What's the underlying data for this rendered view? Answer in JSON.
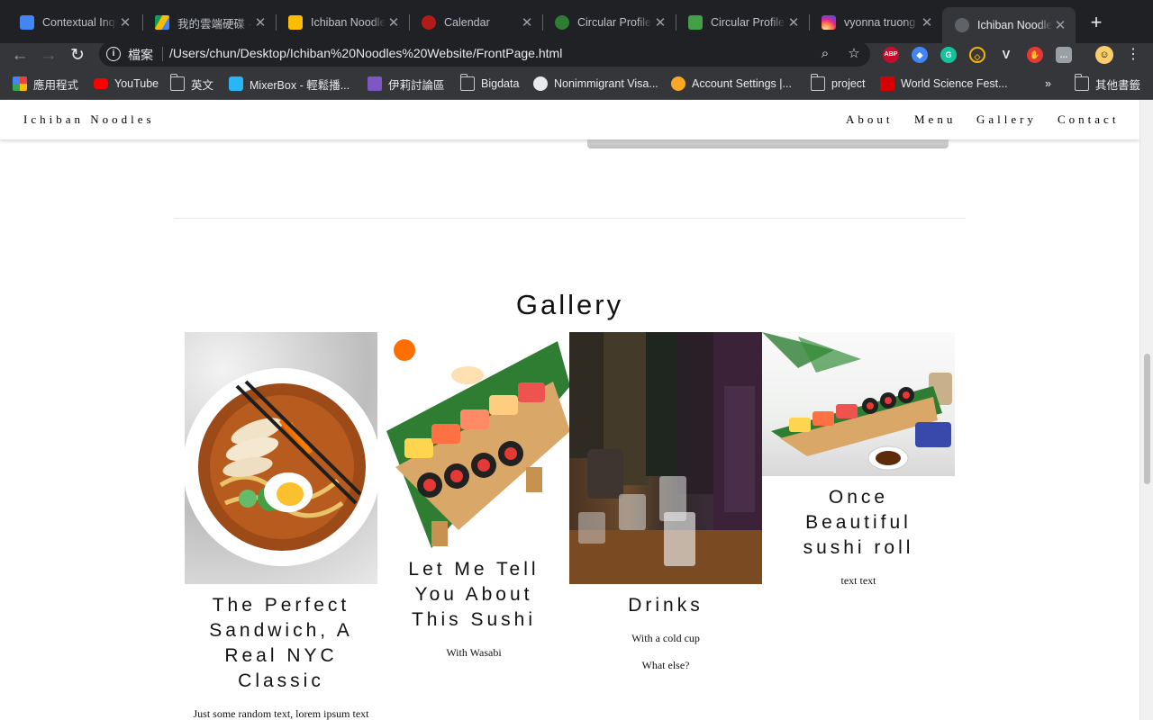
{
  "tabs": [
    {
      "title": "Contextual Inqu",
      "favicon_color": "#4285f4"
    },
    {
      "title": "我的雲端硬碟 -",
      "favicon_color": "#0f9d58"
    },
    {
      "title": "Ichiban Noodle",
      "favicon_color": "#fbbc04"
    },
    {
      "title": "Calendar",
      "favicon_color": "#b31b1b"
    },
    {
      "title": "Circular Profile",
      "favicon_color": "#2e7d32"
    },
    {
      "title": "Circular Profile",
      "favicon_color": "#43a047"
    },
    {
      "title": "vyonna truong",
      "favicon_color": "#d62976"
    },
    {
      "title": "Ichiban Noodle",
      "favicon_color": "#5f6368"
    }
  ],
  "omnibox": {
    "security_label": "檔案",
    "url": "/Users/chun/Desktop/Ichiban%20Noodles%20Website/FrontPage.html"
  },
  "extensions": [
    {
      "label": "ABP",
      "color": "#c70d2c"
    },
    {
      "label": "◆",
      "color": "#4285f4"
    },
    {
      "label": "G",
      "color": "#15c39a"
    },
    {
      "label": "◇",
      "color": "#f4b400"
    },
    {
      "label": "V",
      "color": "#35363a"
    },
    {
      "label": "✋",
      "color": "#e53935"
    },
    {
      "label": "…",
      "color": "#9aa0a6"
    }
  ],
  "bookmarks": [
    {
      "label": "應用程式",
      "icon": "apps-grid-icon"
    },
    {
      "label": "YouTube",
      "icon": "youtube-icon"
    },
    {
      "label": "英文",
      "icon": "folder-icon"
    },
    {
      "label": "MixerBox - 輕鬆播...",
      "icon": "mixerbox-icon"
    },
    {
      "label": "伊莉討論區",
      "icon": "eyny-icon"
    },
    {
      "label": "Bigdata",
      "icon": "folder-icon"
    },
    {
      "label": "Nonimmigrant Visa...",
      "icon": "globe-icon"
    },
    {
      "label": "Account Settings |...",
      "icon": "c-logo-icon"
    },
    {
      "label": "project",
      "icon": "folder-icon"
    },
    {
      "label": "World Science Fest...",
      "icon": "wsf-icon"
    }
  ],
  "other_bookmarks": "其他書籤",
  "site": {
    "brand": "Ichiban Noodles",
    "nav": [
      "About",
      "Menu",
      "Gallery",
      "Contact"
    ]
  },
  "gallery": {
    "title": "Gallery",
    "cards": [
      {
        "title": "The Perfect Sandwich, A Real NYC Classic",
        "texts": [
          "Just some random text, lorem ipsum text"
        ]
      },
      {
        "title": "Let Me Tell You About This Sushi",
        "texts": [
          "With Wasabi"
        ]
      },
      {
        "title": "Drinks",
        "texts": [
          "With a cold cup",
          "What else?"
        ]
      },
      {
        "title": "Once Beautiful sushi roll",
        "texts": [
          "text text"
        ]
      }
    ]
  }
}
